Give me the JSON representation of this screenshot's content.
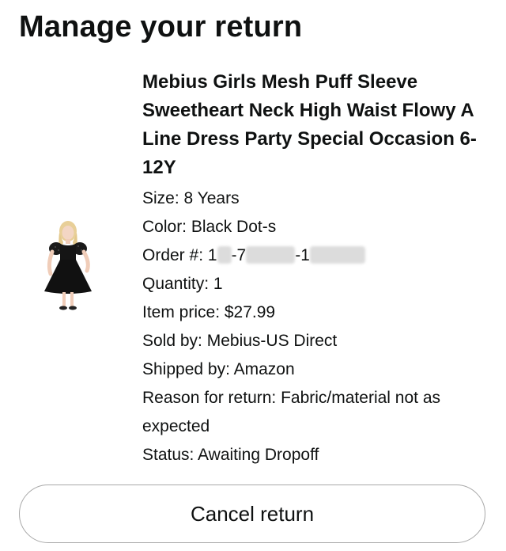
{
  "page": {
    "title": "Manage your return"
  },
  "item": {
    "image": "product-image-dress",
    "title": "Mebius Girls Mesh Puff Sleeve Sweetheart Neck High Waist Flowy A Line Dress Party Special Occasion 6-12Y",
    "size": "Size: 8 Years",
    "color": "Color: Black Dot-s",
    "order_prefix": "Order #: 1",
    "order_mid": "-7",
    "order_end": "-1",
    "quantity": "Quantity: 1",
    "price": "Item price: $27.99",
    "sold_by": "Sold by: Mebius-US Direct",
    "shipped_by": "Shipped by: Amazon",
    "reason": "Reason for return: Fabric/material not as expected",
    "status": "Status: Awaiting Dropoff"
  },
  "actions": {
    "cancel_label": "Cancel return"
  }
}
